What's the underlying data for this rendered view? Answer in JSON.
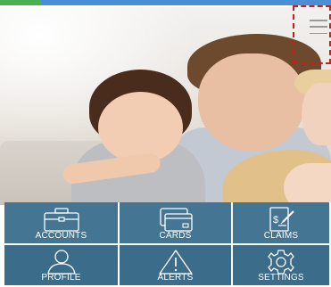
{
  "header": {
    "menu_icon": "hamburger-menu-icon"
  },
  "colors": {
    "top_strip": "#4a8fd6",
    "top_accent": "#4caf50",
    "tile_bg": "#3b6c8a",
    "highlight": "#d11a1a"
  },
  "hero": {
    "image": "family-photo"
  },
  "tiles": [
    {
      "label": "ACCOUNTS",
      "icon": "briefcase-icon"
    },
    {
      "label": "CARDS",
      "icon": "credit-card-icon"
    },
    {
      "label": "CLAIMS",
      "icon": "claim-document-icon"
    },
    {
      "label": "PROFILE",
      "icon": "user-icon"
    },
    {
      "label": "ALERTS",
      "icon": "warning-icon"
    },
    {
      "label": "SETTINGS",
      "icon": "gear-icon"
    }
  ]
}
